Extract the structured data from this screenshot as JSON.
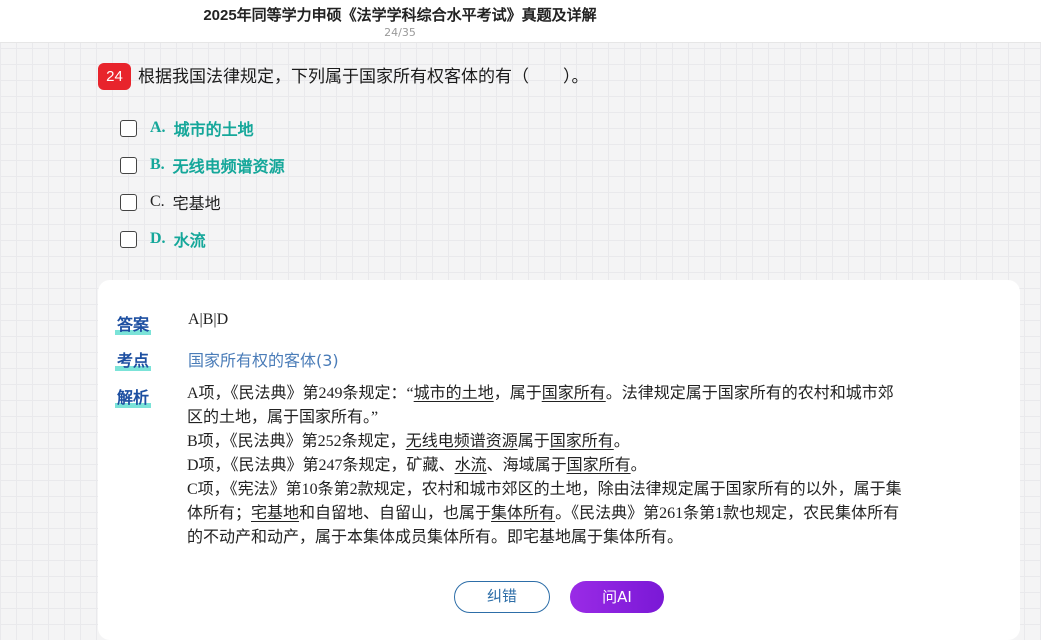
{
  "header": {
    "title": "2025年同等学力申硕《法学学科综合水平考试》真题及详解",
    "page_counter": "24/35"
  },
  "question": {
    "number": "24",
    "text": "根据我国法律规定，下列属于国家所有权客体的有（　　）。",
    "options": [
      {
        "letter": "A.",
        "text": "城市的土地",
        "correct": true
      },
      {
        "letter": "B.",
        "text": "无线电频谱资源",
        "correct": true
      },
      {
        "letter": "C.",
        "text": "宅基地",
        "correct": false
      },
      {
        "letter": "D.",
        "text": "水流",
        "correct": true
      }
    ]
  },
  "answer": {
    "answer_label": "答案",
    "answer_value": "A|B|D",
    "point_label": "考点",
    "point_value": "国家所有权的客体(3)",
    "analysis_label": "解析",
    "analysis": {
      "a1": "A项，《民法典》第249条规定：“",
      "a2": "城市的土地",
      "a3": "，属于",
      "a4": "国家所有",
      "a5": "。法律规定属于国家所有的农村和城市郊",
      "a6": "区的土地，属于国家所有。”",
      "b1": "B项，《民法典》第252条规定，",
      "b2": "无线电频谱资源",
      "b3": "属于",
      "b4": "国家所有",
      "b5": "。",
      "d1": "D项，《民法典》第247条规定，矿藏、",
      "d2": "水流",
      "d3": "、海域属于",
      "d4": "国家所有",
      "d5": "。",
      "c1": "C项，《宪法》第10条第2款规定，农村和城市郊区的土地，除由法律规定属于国家所有的以外，属于集",
      "c2": "体所有；",
      "c3": "宅基地",
      "c4": "和自留地、自留山，也属于",
      "c5": "集体所有",
      "c6": "。《民法典》第261条第1款也规定，农民集体所有",
      "c7": "的不动产和动产，属于本集体成员集体所有。即宅基地属于集体所有。"
    }
  },
  "buttons": {
    "report_error": "纠错",
    "ask_ai": "问AI"
  },
  "colors": {
    "accent_red": "#e8242c",
    "correct_teal": "#15a79a",
    "label_blue": "#1d4fa1",
    "ai_purple": "#8a22de"
  }
}
